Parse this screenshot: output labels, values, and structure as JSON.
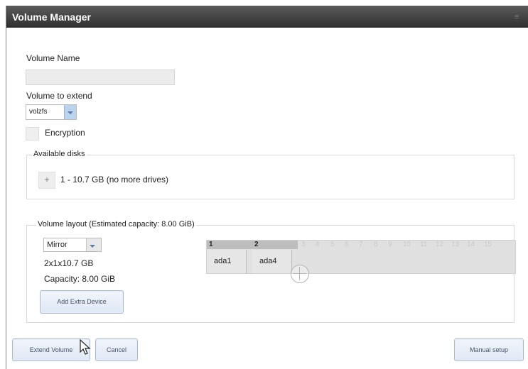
{
  "window": {
    "title": "Volume Manager",
    "title_icon": "menu-icon"
  },
  "form": {
    "volume_name_label": "Volume Name",
    "volume_name_value": "",
    "volume_to_extend_label": "Volume to extend",
    "volume_select_value": "volzfs",
    "encryption_label": "Encryption"
  },
  "available_disks": {
    "legend": "Available disks",
    "plus": "+",
    "text": "1 - 10.7 GB (no more drives)"
  },
  "volume_layout": {
    "legend": "Volume layout (Estimated capacity: 8.00 GiB)",
    "layout_select": "Mirror",
    "size_text": "2x1x10.7 GB",
    "capacity_text": "Capacity: 8.00 GiB",
    "add_extra_device": "Add Extra Device",
    "numbers": [
      "1",
      "2",
      "3",
      "4",
      "5",
      "6",
      "7",
      "8",
      "9",
      "10",
      "11",
      "12",
      "13",
      "14",
      "15"
    ],
    "devices": [
      "ada1",
      "ada4"
    ]
  },
  "buttons": {
    "extend": "Extend Volume",
    "cancel": "Cancel",
    "manual": "Manual setup"
  },
  "colors": {
    "accent": "#dfe8f5",
    "titlebar": "#3e3e3e"
  }
}
